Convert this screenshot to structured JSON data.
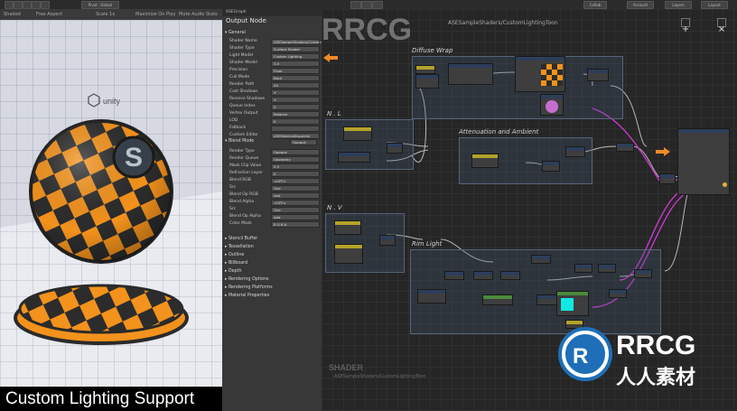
{
  "topbar": {
    "window_tabs": [
      "Scene",
      "Game",
      "Asset Store"
    ],
    "scene_menu": [
      "Shaded",
      "2D",
      "Gizmos"
    ],
    "ase_tab": "ASEGraph",
    "right_buttons": [
      "Collab",
      "Account",
      "Layers",
      "Layout"
    ]
  },
  "scene": {
    "toolbar_left": "Shaded",
    "toolbar_mid": "Free Aspect",
    "toolbar_right": "Scale 1x",
    "play_modes": [
      "Maximize On Play",
      "Mute Audio",
      "Stats"
    ],
    "logo": "unity"
  },
  "inspector": {
    "title": "Output Node",
    "sections": {
      "general": "General",
      "blend_mode": "Blend Mode",
      "blend_mode_value": "Opaque",
      "stencil": "Stencil Buffer",
      "tessellation": "Tessellation",
      "outline": "Outline",
      "billboard": "Billboard",
      "depth": "Depth",
      "rendering_options": "Rendering Options",
      "rendering_platforms": "Rendering Platforms",
      "material_properties": "Material Properties"
    },
    "general_props": [
      {
        "label": "Shader Name",
        "value": "ASESampleShaders/CustomLightingToon"
      },
      {
        "label": "Shader Type",
        "value": "Surface Shader"
      },
      {
        "label": "Light Model",
        "value": "Custom Lighting"
      },
      {
        "label": "Shader Model",
        "value": "3.0"
      },
      {
        "label": "Precision",
        "value": "Float"
      },
      {
        "label": "Cull Mode",
        "value": "Back"
      },
      {
        "label": "Render Path",
        "value": "All"
      },
      {
        "label": "Cast Shadows",
        "value": "✔"
      },
      {
        "label": "Receive Shadows",
        "value": "✔"
      },
      {
        "label": "Queue Index",
        "value": "0"
      },
      {
        "label": "Vertex Output",
        "value": "Relative"
      },
      {
        "label": "LOD",
        "value": "0"
      },
      {
        "label": "Fallback",
        "value": ""
      },
      {
        "label": "Custom Editor",
        "value": "ASEMaterialInspector"
      }
    ],
    "blend_props": [
      {
        "label": "Render Type",
        "value": "Opaque"
      },
      {
        "label": "Render Queue",
        "value": "Geometry"
      },
      {
        "label": "Mask Clip Value",
        "value": "0.5"
      },
      {
        "label": "Refraction Layer",
        "value": "0"
      },
      {
        "label": "Blend RGB",
        "value": "<OFF>"
      },
      {
        "label": "Src",
        "value": "One"
      },
      {
        "label": "Blend Op RGB",
        "value": "Add"
      },
      {
        "label": "Blend Alpha",
        "value": "<OFF>"
      },
      {
        "label": "Src",
        "value": "One"
      },
      {
        "label": "Blend Op Alpha",
        "value": "Add"
      },
      {
        "label": "Color Mask",
        "value": "R G B A"
      }
    ]
  },
  "graph": {
    "title": "ASESampleShaders/CustomLightingToon",
    "groups": {
      "diffuse": "Diffuse Wrap",
      "nl": "N . L",
      "atten": "Attenuation and Ambient",
      "nv": "N . V",
      "rim": "Rim Light"
    },
    "footer_brand": "SHADER",
    "footer_path": "ASESampleShaders/CustomLightingToon"
  },
  "caption": "Custom Lighting Support",
  "watermark": {
    "brand": "RRCG",
    "cn": "人人素材"
  },
  "colors": {
    "accent_orange": "#f08a24",
    "wire_magenta": "#d33ad8",
    "checker_orange": "#f3921c",
    "checker_dark": "#2c2c2c",
    "cyan_preview": "#12e8e2"
  }
}
